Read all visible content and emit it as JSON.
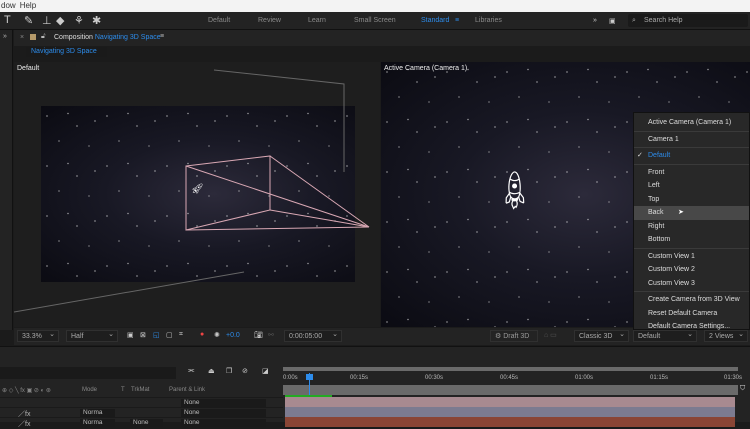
{
  "menubar": {
    "items": [
      "dow",
      "Help"
    ]
  },
  "workspaces": [
    "Default",
    "Review",
    "Learn",
    "Small Screen",
    "Standard",
    "Libraries"
  ],
  "active_workspace": "Standard",
  "search": {
    "placeholder": "Search Help"
  },
  "composition": {
    "tab_prefix": "Composition",
    "name": "Navigating 3D Space",
    "subtab": "Navigating 3D Space"
  },
  "views": {
    "left_label": "Default",
    "right_label": "Active Camera (Camera 1)"
  },
  "menu": {
    "items": [
      {
        "label": "Active Camera (Camera 1)",
        "group": 0
      },
      {
        "label": "Camera 1",
        "group": 1
      },
      {
        "label": "Default",
        "group": 2,
        "checked": true
      },
      {
        "label": "Front",
        "group": 3
      },
      {
        "label": "Left",
        "group": 3
      },
      {
        "label": "Top",
        "group": 3
      },
      {
        "label": "Back",
        "group": 3,
        "hover": true
      },
      {
        "label": "Right",
        "group": 3
      },
      {
        "label": "Bottom",
        "group": 3
      },
      {
        "label": "Custom View 1",
        "group": 4
      },
      {
        "label": "Custom View 2",
        "group": 4
      },
      {
        "label": "Custom View 3",
        "group": 4
      },
      {
        "label": "Create Camera from 3D View",
        "group": 5
      },
      {
        "label": "Reset Default Camera",
        "group": 5
      },
      {
        "label": "Default Camera Settings...",
        "group": 5
      }
    ]
  },
  "viewer_toolbar": {
    "zoom": "33.3%",
    "resolution": "Half",
    "exposure": "+0.0",
    "timecode": "0:00:05:00",
    "draft3d": "Draft 3D",
    "renderer": "Classic 3D",
    "view": "Default",
    "layout": "2 Views"
  },
  "timeline": {
    "headers": {
      "mode": "Mode",
      "t": "T",
      "trkmat": "TrkMat",
      "parent": "Parent & Link"
    },
    "ruler": [
      "0:00s",
      "00:15s",
      "00:30s",
      "00:45s",
      "01:00s",
      "01:15s",
      "01:30s"
    ],
    "rows": [
      {
        "mode": "",
        "parent": "None",
        "color": "#a88a90"
      },
      {
        "mode": "Norma",
        "parent": "None",
        "color": "#7c7b90"
      },
      {
        "mode": "Norma",
        "trkmat": "None",
        "parent": "None",
        "color": "#8a4535"
      }
    ]
  },
  "colors": {
    "accent": "#2d8ceb"
  }
}
